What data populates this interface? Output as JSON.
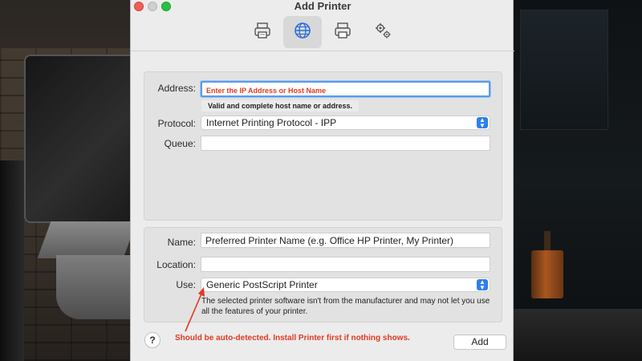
{
  "window": {
    "title": "Add Printer"
  },
  "toolbar": {
    "buttons": [
      {
        "icon": "printer-icon",
        "selected": false
      },
      {
        "icon": "globe-icon",
        "selected": true
      },
      {
        "icon": "printer-icon",
        "selected": false
      },
      {
        "icon": "gear-icon",
        "selected": false
      }
    ]
  },
  "connection": {
    "address_label": "Address:",
    "address_value": "Enter the IP Address or Host Name",
    "address_hint": "Valid and complete host name or address.",
    "protocol_label": "Protocol:",
    "protocol_value": "Internet Printing Protocol - IPP",
    "queue_label": "Queue:",
    "queue_value": ""
  },
  "details": {
    "name_label": "Name:",
    "name_value": "Preferred Printer Name (e.g. Office HP Printer, My Printer)",
    "location_label": "Location:",
    "location_value": "",
    "use_label": "Use:",
    "use_value": "Generic PostScript Printer",
    "use_description": "The selected printer software isn't from the manufacturer and may not let you use all the features of your printer."
  },
  "footer": {
    "help_label": "?",
    "annotation": "Should be auto-detected. Install Printer first if nothing shows.",
    "add_label": "Add"
  },
  "colors": {
    "annotation": "#e03a24",
    "accent": "#2d7ff0",
    "focus_ring": "#5b9be8"
  }
}
